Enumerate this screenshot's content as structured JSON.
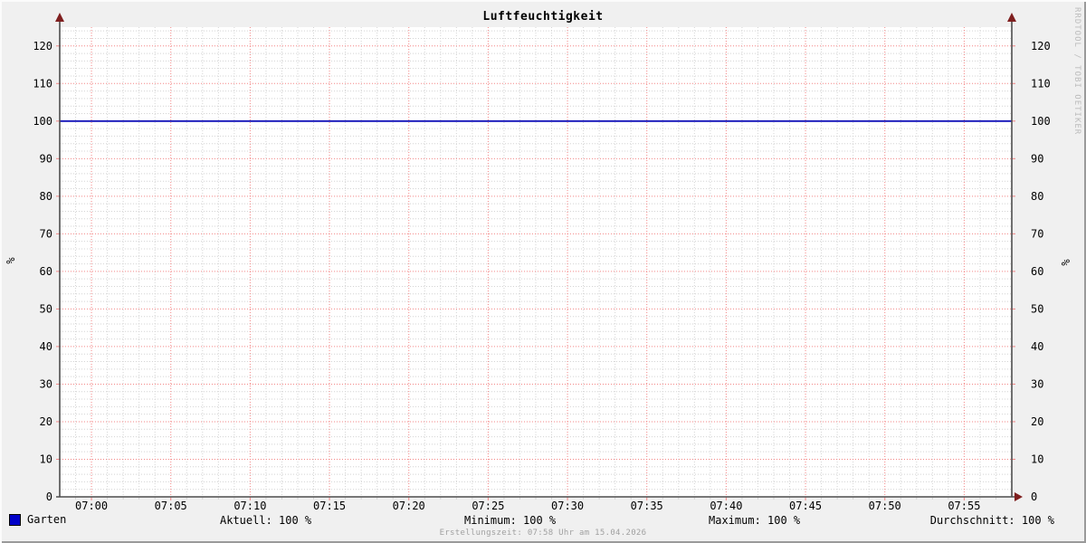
{
  "title": "Luftfeuchtigkeit",
  "watermark": "RRDTOOL / TOBI OETIKER",
  "footer": "Erstellungszeit: 07:58 Uhr am 15.04.2026",
  "legend": {
    "series_label": "Garten",
    "aktuell": "Aktuell: 100 %",
    "minimum": "Minimum: 100 %",
    "maximum": "Maximum: 100 %",
    "durchschnitt": "Durchschnitt: 100 %"
  },
  "colors": {
    "background": "#f0f0f0",
    "canvas": "#ffffff",
    "grid_minor": "#d4d4d4",
    "grid_major": "#f38686",
    "axis": "#4d4d4d",
    "arrow": "#7f1f1f",
    "series": "#1212b8",
    "legend_swatch": "#0000c8",
    "text": "#000000",
    "footer_text": "#a0a0a0",
    "watermark_text": "#bcbcbc",
    "border_light": "#fbfbfb",
    "border_dark": "#9a9a9a"
  },
  "chart_data": {
    "type": "line",
    "title": "Luftfeuchtigkeit",
    "ylabel_left": "%",
    "ylabel_right": "%",
    "ylim": [
      0,
      125
    ],
    "y_major_step": 10,
    "y_minor_step": 2,
    "y_label_max": 120,
    "x_start": "06:58",
    "x_end": "07:58",
    "x_start_minute": 418,
    "x_end_minute": 478,
    "x_minor_step_minutes": 1,
    "x_major_step_minutes": 5,
    "grid": true,
    "legend_position": "bottom",
    "x_ticks": [
      {
        "minute": 420,
        "label": "07:00"
      },
      {
        "minute": 425,
        "label": "07:05"
      },
      {
        "minute": 430,
        "label": "07:10"
      },
      {
        "minute": 435,
        "label": "07:15"
      },
      {
        "minute": 440,
        "label": "07:20"
      },
      {
        "minute": 445,
        "label": "07:25"
      },
      {
        "minute": 450,
        "label": "07:30"
      },
      {
        "minute": 455,
        "label": "07:35"
      },
      {
        "minute": 460,
        "label": "07:40"
      },
      {
        "minute": 465,
        "label": "07:45"
      },
      {
        "minute": 470,
        "label": "07:50"
      },
      {
        "minute": 475,
        "label": "07:55"
      }
    ],
    "series": [
      {
        "name": "Garten",
        "color": "#1212b8",
        "unit": "%",
        "points": [
          {
            "minute": 418,
            "value": 100
          },
          {
            "minute": 478,
            "value": 100
          }
        ],
        "stats": {
          "aktuell": 100,
          "minimum": 100,
          "maximum": 100,
          "durchschnitt": 100
        }
      }
    ]
  }
}
